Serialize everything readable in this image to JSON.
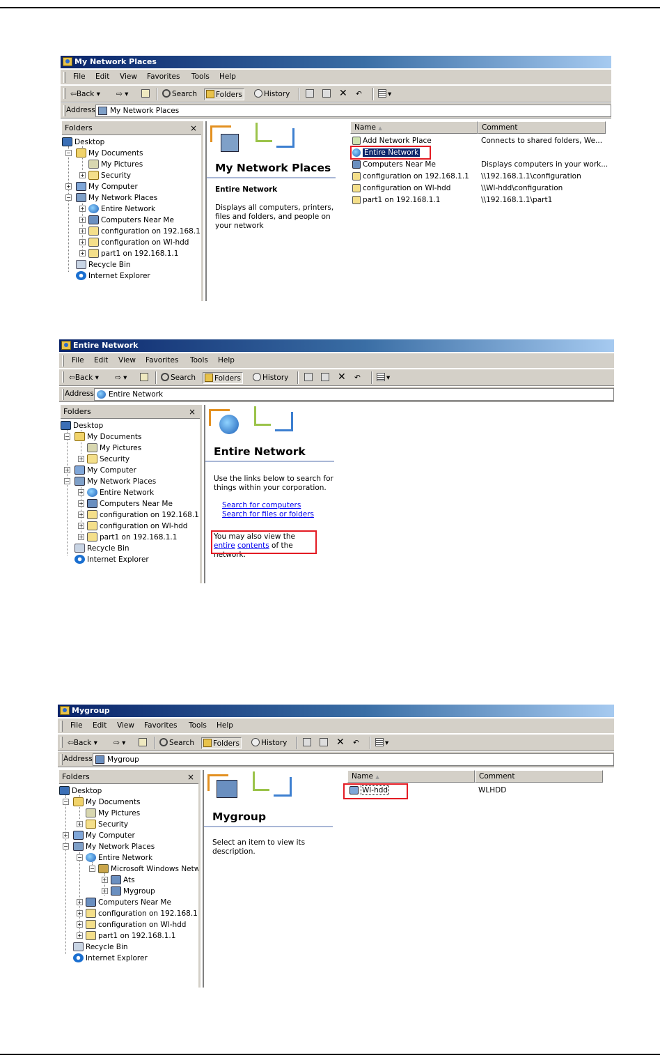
{
  "menu": [
    "File",
    "Edit",
    "View",
    "Favorites",
    "Tools",
    "Help"
  ],
  "toolbar": {
    "back": "Back",
    "search": "Search",
    "folders": "Folders",
    "history": "History"
  },
  "address_label": "Address",
  "folders_label": "Folders",
  "close_glyph": "×",
  "sort_glyph": "▲",
  "col_name": "Name",
  "col_comment": "Comment",
  "tree": {
    "desktop": "Desktop",
    "my_documents": "My Documents",
    "my_pictures": "My Pictures",
    "security": "Security",
    "my_computer": "My Computer",
    "my_network_places": "My Network Places",
    "entire_network": "Entire Network",
    "microsoft_windows_network": "Microsoft Windows Netw",
    "ats": "Ats",
    "mygroup": "Mygroup",
    "computers_near_me": "Computers Near Me",
    "configuration_192": "configuration on 192.168.1.1",
    "configuration_wlhdd": "configuration on Wl-hdd",
    "part1": "part1 on 192.168.1.1",
    "recycle_bin": "Recycle Bin",
    "internet_explorer": "Internet Explorer"
  },
  "windows": [
    {
      "title": "My Network Places",
      "address": "My Network Places",
      "panel_title": "My Network Places",
      "panel_subtitle": "Entire Network",
      "panel_desc": "Displays all computers, printers, files and folders, and people on your network",
      "items": [
        {
          "name": "Add Network Place",
          "comment": "Connects to shared folders, We..."
        },
        {
          "name": "Entire Network",
          "comment": ""
        },
        {
          "name": "Computers Near Me",
          "comment": "Displays computers in your work..."
        },
        {
          "name": "configuration on 192.168.1.1",
          "comment": "\\\\192.168.1.1\\configuration"
        },
        {
          "name": "configuration on Wl-hdd",
          "comment": "\\\\Wl-hdd\\configuration"
        },
        {
          "name": "part1 on 192.168.1.1",
          "comment": "\\\\192.168.1.1\\part1"
        }
      ]
    },
    {
      "title": "Entire Network",
      "address": "Entire Network",
      "panel_title": "Entire Network",
      "panel_desc": "Use the links below to search for things within your corporation.",
      "link_search_computers": "Search for computers",
      "link_search_files": "Search for files or folders",
      "note_prefix": "You may also view the ",
      "note_link_1": "entire",
      "note_link_2": "contents",
      "note_suffix": " of the network."
    },
    {
      "title": "Mygroup",
      "address": "Mygroup",
      "panel_title": "Mygroup",
      "panel_desc": "Select an item to view its description.",
      "items": [
        {
          "name": "Wl-hdd",
          "comment": "WLHDD"
        }
      ]
    }
  ],
  "colors": {
    "titlebar": "#0a246a",
    "chrome": "#d4d0c8",
    "highlight": "#e31b23",
    "selection": "#0a246a"
  }
}
